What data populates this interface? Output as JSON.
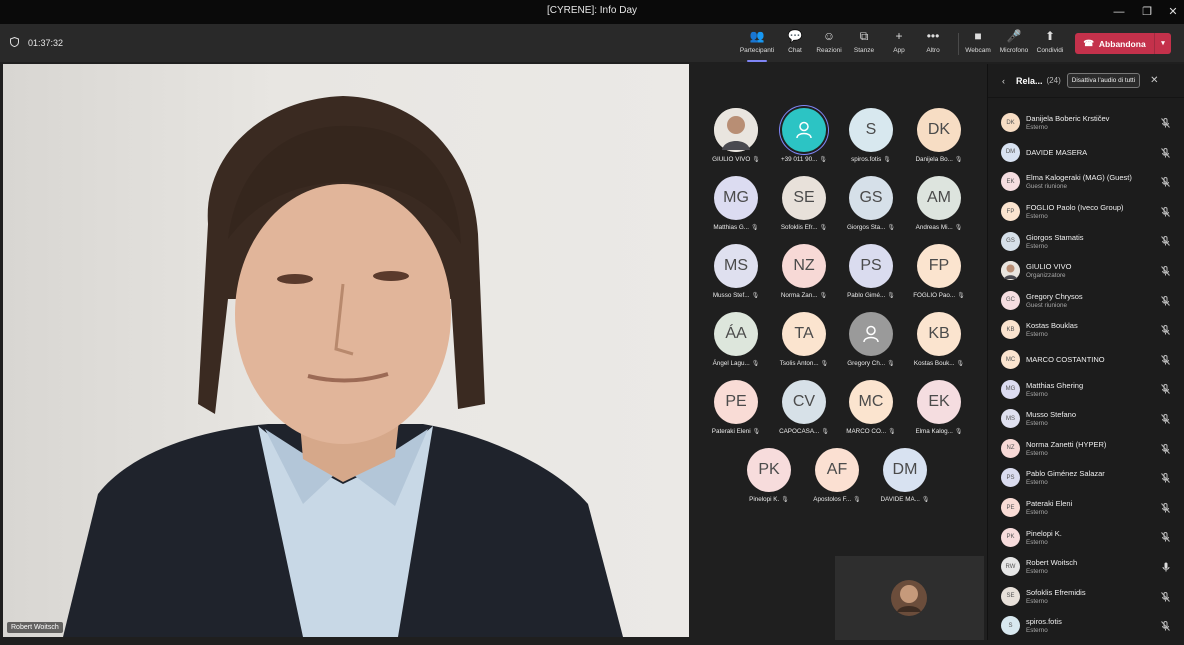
{
  "window": {
    "title": "[CYRENE]: Info Day",
    "minimize": "—",
    "restore": "❐",
    "close": "✕"
  },
  "toolbar": {
    "timer": "01:37:32",
    "buttons": [
      {
        "id": "participants",
        "label": "Partecipanti",
        "icon": "👥"
      },
      {
        "id": "chat",
        "label": "Chat",
        "icon": "💬"
      },
      {
        "id": "reactions",
        "label": "Reazioni",
        "icon": "☺"
      },
      {
        "id": "rooms",
        "label": "Stanze",
        "icon": "⧉"
      },
      {
        "id": "apps",
        "label": "App",
        "icon": "+"
      },
      {
        "id": "more",
        "label": "Altro",
        "icon": "•••"
      },
      {
        "id": "webcam",
        "label": "Webcam",
        "icon": "■"
      },
      {
        "id": "mic",
        "label": "Microfono",
        "icon": "🎤"
      },
      {
        "id": "share",
        "label": "Condividi",
        "icon": "⬆"
      }
    ],
    "leave_label": "Abbandona",
    "leave_icon": "☎",
    "leave_dropdown": "▾"
  },
  "video": {
    "speaker_name": "Robert Woitsch"
  },
  "grid": {
    "mic_icon": "🎙",
    "tiles": [
      {
        "initials": "",
        "name": "GIULIO VIVO",
        "color": "#d9d4cc",
        "photo": true
      },
      {
        "initials": "",
        "name": "+39 011 90...",
        "color": "#2cc4c4",
        "person": true
      },
      {
        "initials": "S",
        "name": "spiros.fotis",
        "color": "#d8e8ef"
      },
      {
        "initials": "DK",
        "name": "Danijela Bo...",
        "color": "#f7ddc4"
      },
      {
        "initials": "MG",
        "name": "Matthias G...",
        "color": "#dcdcf1"
      },
      {
        "initials": "SE",
        "name": "Sofoklis Efr...",
        "color": "#e8e1da"
      },
      {
        "initials": "GS",
        "name": "Giorgos Sta...",
        "color": "#d6e0e9"
      },
      {
        "initials": "AM",
        "name": "Andreas Mi...",
        "color": "#dde4de"
      },
      {
        "initials": "MS",
        "name": "Musso Stef...",
        "color": "#dfe0ef"
      },
      {
        "initials": "NZ",
        "name": "Norma Zan...",
        "color": "#f7d9d6"
      },
      {
        "initials": "PS",
        "name": "Pablo Gimé...",
        "color": "#dadcef"
      },
      {
        "initials": "FP",
        "name": "FOGLIO Pao...",
        "color": "#fbe4cf"
      },
      {
        "initials": "ÁA",
        "name": "Ángel Lagu...",
        "color": "#dde6dc"
      },
      {
        "initials": "TA",
        "name": "Tsolis Anton...",
        "color": "#fbe4cf"
      },
      {
        "initials": "",
        "name": "Gregory Ch...",
        "color": "#9a9a9a",
        "person": true
      },
      {
        "initials": "KB",
        "name": "Kostas Bouk...",
        "color": "#fbe4cf"
      },
      {
        "initials": "PE",
        "name": "Pateraki Eleni",
        "color": "#f9dcd6"
      },
      {
        "initials": "CV",
        "name": "CAPOCASA...",
        "color": "#d7e1e8"
      },
      {
        "initials": "MC",
        "name": "MARCO CO...",
        "color": "#fbe4cf"
      },
      {
        "initials": "EK",
        "name": "Elma Kalog...",
        "color": "#f5dde0"
      },
      {
        "initials": "PK",
        "name": "Pinelopi K.",
        "color": "#f7dcdc"
      },
      {
        "initials": "AF",
        "name": "Apostolos F...",
        "color": "#fbe0d2"
      },
      {
        "initials": "DM",
        "name": "DAVIDE MA...",
        "color": "#d8e2f1"
      }
    ]
  },
  "panel": {
    "title": "Rela...",
    "count": "(24)",
    "mute_all": "Disattiva l'audio di tutti",
    "back_icon": "‹",
    "close_icon": "✕",
    "participants": [
      {
        "initials": "DK",
        "name": "Danijela Boberic Krstičev",
        "sub": "Esterno",
        "color": "#f7ddc4",
        "mic": "muted"
      },
      {
        "initials": "DM",
        "name": "DAVIDE MASERA",
        "sub": "",
        "color": "#d8e2f1",
        "mic": "muted"
      },
      {
        "initials": "EK",
        "name": "Elma Kalogeraki (MAG) (Guest)",
        "sub": "Guest riunione",
        "color": "#f5dde0",
        "mic": "muted"
      },
      {
        "initials": "FP",
        "name": "FOGLIO Paolo (Iveco Group)",
        "sub": "Esterno",
        "color": "#fbe4cf",
        "mic": "muted"
      },
      {
        "initials": "GS",
        "name": "Giorgos Stamatis",
        "sub": "Esterno",
        "color": "#d6e0e9",
        "mic": "muted"
      },
      {
        "initials": "",
        "name": "GIULIO VIVO",
        "sub": "Organizzatore",
        "color": "#bdb3a8",
        "mic": "muted"
      },
      {
        "initials": "GC",
        "name": "Gregory Chrysos",
        "sub": "Guest riunione",
        "color": "#f5dde0",
        "mic": "muted"
      },
      {
        "initials": "KB",
        "name": "Kostas Bouklas",
        "sub": "Esterno",
        "color": "#fbe4cf",
        "mic": "muted"
      },
      {
        "initials": "MC",
        "name": "MARCO COSTANTINO",
        "sub": "",
        "color": "#fbe4cf",
        "mic": "muted"
      },
      {
        "initials": "MG",
        "name": "Matthias Ghering",
        "sub": "Esterno",
        "color": "#dcdcf1",
        "mic": "muted"
      },
      {
        "initials": "MS",
        "name": "Musso Stefano",
        "sub": "Esterno",
        "color": "#dfe0ef",
        "mic": "muted"
      },
      {
        "initials": "NZ",
        "name": "Norma Zanetti (HYPER)",
        "sub": "Esterno",
        "color": "#f7d9d6",
        "mic": "muted"
      },
      {
        "initials": "PS",
        "name": "Pablo Giménez Salazar",
        "sub": "Esterno",
        "color": "#dadcef",
        "mic": "muted"
      },
      {
        "initials": "PE",
        "name": "Pateraki Eleni",
        "sub": "Esterno",
        "color": "#f9dcd6",
        "mic": "muted"
      },
      {
        "initials": "PK",
        "name": "Pinelopi K.",
        "sub": "Esterno",
        "color": "#f7dcdc",
        "mic": "muted"
      },
      {
        "initials": "RW",
        "name": "Robert Woitsch",
        "sub": "Esterno",
        "color": "#e6e6e6",
        "mic": "on"
      },
      {
        "initials": "SE",
        "name": "Sofoklis Efremidis",
        "sub": "Esterno",
        "color": "#e8e1da",
        "mic": "muted"
      },
      {
        "initials": "S",
        "name": "spiros.fotis",
        "sub": "Esterno",
        "color": "#d8e8ef",
        "mic": "muted"
      }
    ]
  }
}
